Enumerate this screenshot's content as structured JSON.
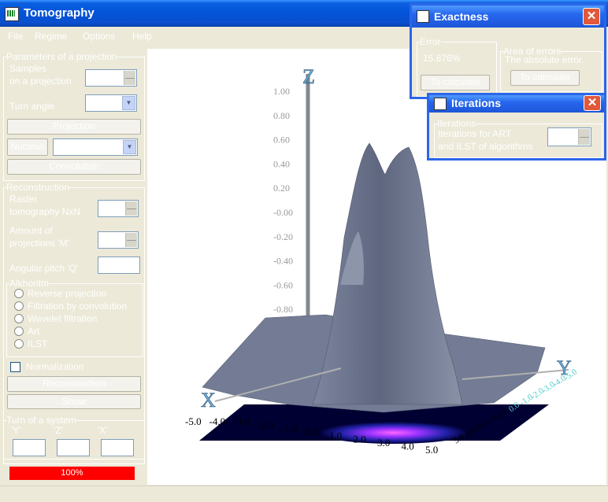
{
  "window": {
    "title": "Tomography"
  },
  "menu": [
    "File",
    "Regime",
    "Options",
    "Help"
  ],
  "projection": {
    "legend": "Parameters of a projection",
    "samples_label_1": "Samples",
    "samples_label_2": "on a projection",
    "turn_angle_label": "Turn angle",
    "projection_button": "Projection",
    "nucleus_button": "Nucleus",
    "convolution_button": "Convolution"
  },
  "reconstruction": {
    "legend": "Reconstruction",
    "raster_label_1": "Raster",
    "raster_label_2": "tomography NxN",
    "amount_label_1": "Amount of",
    "amount_label_2": "projections 'M'",
    "pitch_label": "Angular pitch 'Q'",
    "algorithm_legend": "Alkhoritm",
    "algorithms": [
      "Reverse projection",
      "Filtration by convolution",
      "Wavelet filtration",
      "Art",
      "ILST"
    ],
    "normalization_label": "Normalization",
    "reconstruction_button": "Reconstruction",
    "show_button": "Show"
  },
  "turn_system": {
    "legend": "Turn of a system",
    "labels": [
      "'Y'",
      "'Z'",
      "'X'"
    ]
  },
  "progress": {
    "percent": 100,
    "label": "100%"
  },
  "plot": {
    "z_axis_label": "Z",
    "x_axis_label": "X",
    "y_axis_label": "Y",
    "z_ticks": [
      "1.00",
      "0.80",
      "0.60",
      "0.40",
      "0.20",
      "-0.00",
      "-0.20",
      "-0.40",
      "-0.60",
      "-0.80"
    ],
    "x_ticks": [
      "-5.0",
      "-4.0",
      "-3.0",
      "-2.0",
      "-1.0",
      "0.0",
      "1.0",
      "2.0",
      "3.0",
      "4.0",
      "5.0"
    ],
    "y_ticks": [
      "5.0",
      "4.0",
      "3.0",
      "2.0",
      "1.0",
      "0.0",
      "-1.0",
      "-2.0",
      "-3.0",
      "-4.0",
      "-5.0"
    ],
    "surface_color": "#6b7590",
    "floor_color": "#000033"
  },
  "exactness": {
    "title": "Exactness",
    "error_legend": "Error",
    "error_value": "15.876%",
    "calc_button": "To calculate",
    "area_legend": "Area of errors",
    "area_text": "The absolute error.",
    "area_calc_button": "To calculate"
  },
  "iterations": {
    "title": "Iterations",
    "legend": "Iterations",
    "label_1": "Iterations for ART",
    "label_2": "and ILST of algorithms"
  }
}
